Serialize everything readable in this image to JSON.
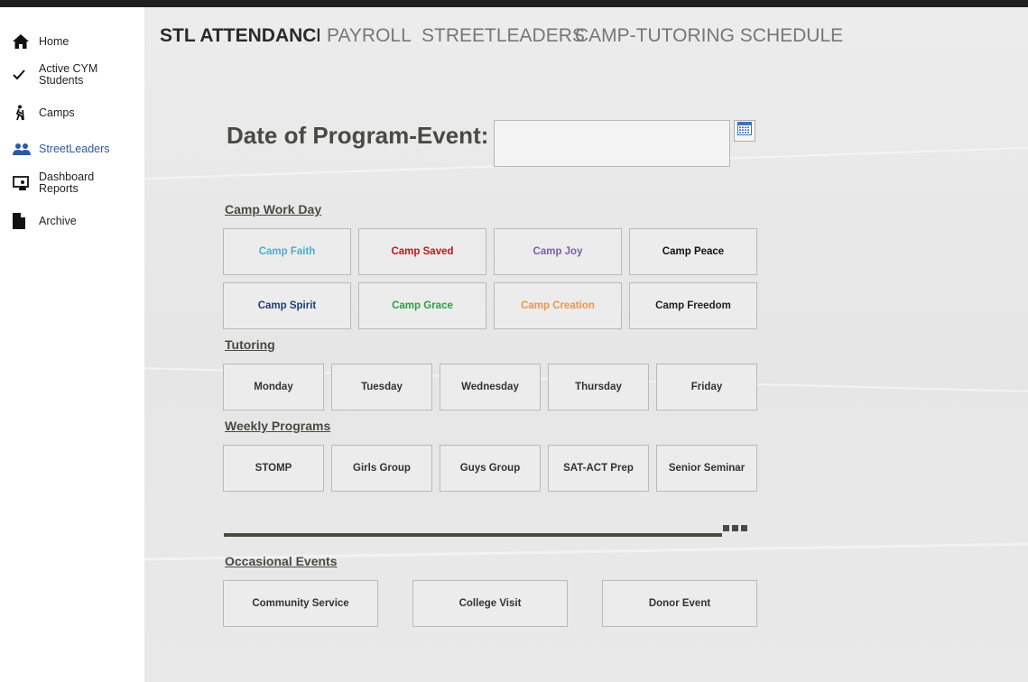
{
  "sidebar": {
    "items": [
      {
        "label": "Home",
        "icon": "home-icon"
      },
      {
        "label": "Active CYM Students",
        "icon": "checkmark-icon"
      },
      {
        "label": "Camps",
        "icon": "hiking-person-icon"
      },
      {
        "label": "StreetLeaders",
        "icon": "people-icon"
      },
      {
        "label": "Dashboard Reports",
        "icon": "monitor-person-icon"
      },
      {
        "label": "Archive",
        "icon": "document-icon"
      }
    ],
    "active_color": "#2c5aa0"
  },
  "topnav": {
    "tabs": [
      {
        "label": "STL ATTENDANCE"
      },
      {
        "label": "PAYROLL"
      },
      {
        "label": "STREETLEADERS"
      },
      {
        "label": "CAMP-TUTORING SCHEDULE"
      }
    ]
  },
  "form": {
    "date_label": "Date of Program-Event:",
    "date_value": "",
    "calendar_icon": "calendar-icon"
  },
  "camp_work_day": {
    "title": "Camp Work Day",
    "buttons": [
      {
        "label": "Camp Faith",
        "color": "#4aaed0"
      },
      {
        "label": "Camp Saved",
        "color": "#c0141b"
      },
      {
        "label": "Camp Joy",
        "color": "#7b5ea6"
      },
      {
        "label": "Camp Peace",
        "color": "#111111"
      },
      {
        "label": "Camp Spirit",
        "color": "#1f3e7a"
      },
      {
        "label": "Camp Grace",
        "color": "#2aa142"
      },
      {
        "label": "Camp Creation",
        "color": "#f0964a"
      },
      {
        "label": "Camp Freedom",
        "color": "#222222"
      }
    ]
  },
  "tutoring": {
    "title": "Tutoring",
    "buttons": [
      "Monday",
      "Tuesday",
      "Wednesday",
      "Thursday",
      "Friday"
    ]
  },
  "weekly_programs": {
    "title": "Weekly Programs",
    "buttons": [
      "STOMP",
      "Girls Group",
      "Guys Group",
      "SAT-ACT Prep",
      "Senior Seminar"
    ]
  },
  "occasional_events": {
    "title": "Occasional Events",
    "buttons": [
      "Community Service",
      "College Visit",
      "Donor Event"
    ]
  }
}
